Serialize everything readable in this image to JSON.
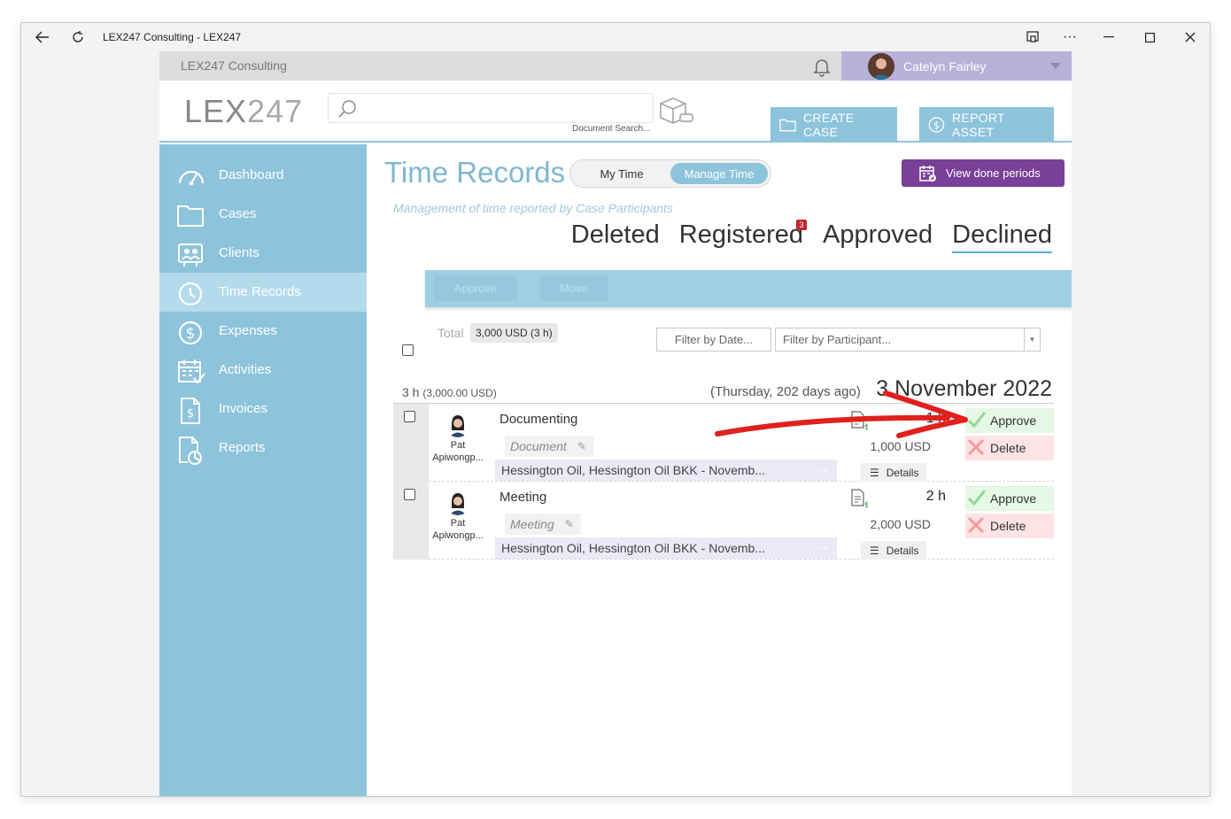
{
  "window": {
    "title": "LEX247 Consulting - LEX247"
  },
  "topbar": {
    "org_name": "LEX247 Consulting",
    "user_name": "Catelyn Fairley"
  },
  "header": {
    "logo_bold": "LEX",
    "logo_thin": "247",
    "search_placeholder": "",
    "search_hint": "Document Search...",
    "create_case": "CREATE CASE",
    "report_asset": "REPORT ASSET"
  },
  "sidebar": {
    "items": [
      {
        "label": "Dashboard",
        "icon": "dashboard-icon"
      },
      {
        "label": "Cases",
        "icon": "folder-icon"
      },
      {
        "label": "Clients",
        "icon": "clients-icon"
      },
      {
        "label": "Time Records",
        "icon": "clock-icon"
      },
      {
        "label": "Expenses",
        "icon": "dollar-icon"
      },
      {
        "label": "Activities",
        "icon": "calendar-icon"
      },
      {
        "label": "Invoices",
        "icon": "invoice-icon"
      },
      {
        "label": "Reports",
        "icon": "report-icon"
      }
    ],
    "active": "Time Records"
  },
  "main": {
    "title": "Time Records",
    "toggle": {
      "my_time": "My Time",
      "manage_time": "Manage Time",
      "selected": "Manage Time"
    },
    "view_done_periods": "View done periods",
    "subtitle": "Management of time reported by Case Participants",
    "tabs": [
      {
        "label": "Deleted",
        "badge": ""
      },
      {
        "label": "Registered",
        "badge": "3"
      },
      {
        "label": "Approved",
        "badge": ""
      },
      {
        "label": "Declined",
        "badge": ""
      }
    ],
    "active_tab": "Declined",
    "actions": {
      "approve": "Approve",
      "move": "Move"
    },
    "total_label": "Total",
    "total_value": "3,000 USD (3 h)",
    "filter_date": "Filter by Date...",
    "filter_participant": "Filter by Participant..."
  },
  "day": {
    "hours": "3 h",
    "amount": "(3,000.00 USD)",
    "relative": "(Thursday, 202 days ago)",
    "date": "3 November 2022"
  },
  "records": [
    {
      "participant_first": "Pat",
      "participant_last": "Apiwongp...",
      "title": "Documenting",
      "category": "Document",
      "case": "Hessington Oil, Hessington Oil BKK - Novemb...",
      "hours": "1 h",
      "amount": "1,000 USD",
      "details": "Details",
      "approve": "Approve",
      "delete": "Delete"
    },
    {
      "participant_first": "Pat",
      "participant_last": "Apiwongp...",
      "title": "Meeting",
      "category": "Meeting",
      "case": "Hessington Oil, Hessington Oil BKK - Novemb...",
      "hours": "2 h",
      "amount": "2,000 USD",
      "details": "Details",
      "approve": "Approve",
      "delete": "Delete"
    }
  ],
  "colors": {
    "sidebar": "#8ec3dc",
    "active_nav": "#b3dbec",
    "purple_button": "#7a3f98",
    "badge": "#c0282d",
    "annotation": "#e0201c"
  }
}
